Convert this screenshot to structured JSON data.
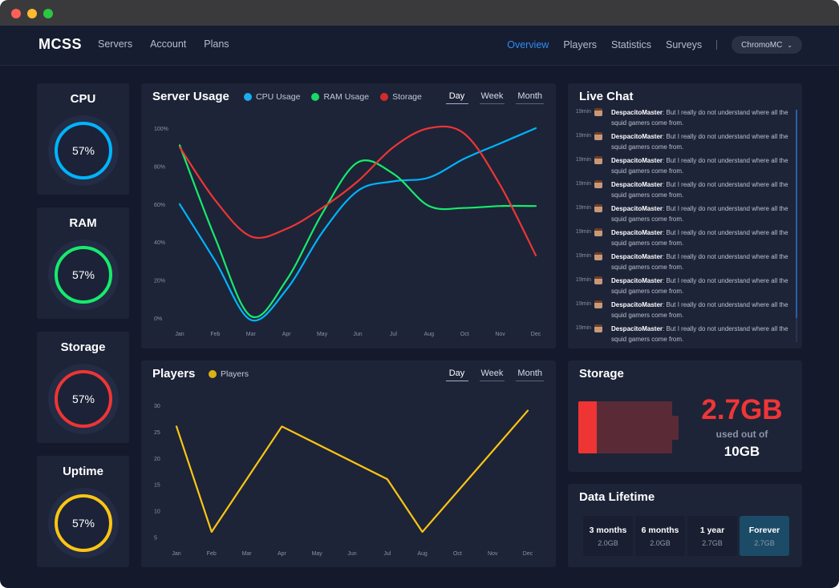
{
  "window": {
    "traffic_lights": [
      "close",
      "minimize",
      "zoom"
    ]
  },
  "nav": {
    "logo": "MCSS",
    "left_links": [
      "Servers",
      "Account",
      "Plans"
    ],
    "right_links": [
      {
        "label": "Overview",
        "active": true
      },
      {
        "label": "Players",
        "active": false
      },
      {
        "label": "Statistics",
        "active": false
      },
      {
        "label": "Surveys",
        "active": false
      }
    ],
    "separator": "|",
    "server_selector": "ChromoMC",
    "server_selector_icon": "chevron-down-icon"
  },
  "stats": [
    {
      "title": "CPU",
      "value": "57%",
      "percent": 57,
      "color": "#00b4ff"
    },
    {
      "title": "RAM",
      "value": "57%",
      "percent": 57,
      "color": "#16eb6c"
    },
    {
      "title": "Storage",
      "value": "57%",
      "percent": 57,
      "color": "#ee3534"
    },
    {
      "title": "Uptime",
      "value": "57%",
      "percent": 57,
      "color": "#fec513"
    }
  ],
  "server_usage": {
    "title": "Server Usage",
    "legend": [
      {
        "label": "CPU Usage",
        "color": "#19aef0"
      },
      {
        "label": "RAM Usage",
        "color": "#19d865"
      },
      {
        "label": "Storage",
        "color": "#d42c2c"
      }
    ],
    "tabs": [
      {
        "label": "Day",
        "active": true
      },
      {
        "label": "Week",
        "active": false
      },
      {
        "label": "Month",
        "active": false
      }
    ]
  },
  "players_panel": {
    "title": "Players",
    "legend": [
      {
        "label": "Players",
        "color": "#d8b217"
      }
    ],
    "tabs": [
      {
        "label": "Day",
        "active": true
      },
      {
        "label": "Week",
        "active": false
      },
      {
        "label": "Month",
        "active": false
      }
    ]
  },
  "chart_data": [
    {
      "type": "line",
      "title": "Server Usage",
      "x": [
        "Jan",
        "Feb",
        "Mar",
        "Apr",
        "May",
        "Jun",
        "Jul",
        "Aug",
        "Oct",
        "Nov",
        "Dec"
      ],
      "yticks": [
        "0%",
        "20%",
        "40%",
        "60%",
        "80%",
        "100%"
      ],
      "ylim": [
        0,
        100
      ],
      "smooth": true,
      "grid": false,
      "legend_position": "top",
      "series": [
        {
          "name": "CPU Usage",
          "color": "#00b4ff",
          "values": [
            60,
            30,
            -1,
            15,
            45,
            67,
            72,
            74,
            84,
            92,
            100
          ]
        },
        {
          "name": "RAM Usage",
          "color": "#16eb6c",
          "values": [
            91,
            42,
            1,
            20,
            55,
            82,
            76,
            59,
            58,
            59,
            59
          ]
        },
        {
          "name": "Storage",
          "color": "#ee3534",
          "values": [
            90,
            62,
            43,
            47,
            58,
            72,
            90,
            100,
            97,
            70,
            33
          ]
        }
      ]
    },
    {
      "type": "line",
      "title": "Players",
      "x": [
        "Jan",
        "Feb",
        "Mar",
        "Apr",
        "May",
        "Jun",
        "Jul",
        "Aug",
        "Oct",
        "Nov",
        "Dec"
      ],
      "yticks": [
        "5",
        "10",
        "15",
        "20",
        "25",
        "30"
      ],
      "ylim": [
        2.5,
        30
      ],
      "smooth": false,
      "grid": false,
      "legend_position": "top",
      "series": [
        {
          "name": "Players",
          "color": "#fec513",
          "points": [
            [
              0,
              26
            ],
            [
              1,
              6
            ],
            [
              2,
              16
            ],
            [
              3,
              26
            ],
            [
              6,
              16
            ],
            [
              7,
              6
            ],
            [
              10,
              29
            ]
          ]
        }
      ]
    }
  ],
  "live_chat": {
    "title": "Live Chat",
    "messages": [
      {
        "time": "19min",
        "user": "DespacitoMaster",
        "text": ": But I really do not understand where all the squid gamers come from."
      },
      {
        "time": "19min",
        "user": "DespacitoMaster",
        "text": ": But I really do not understand where all the squid gamers come from."
      },
      {
        "time": "19min",
        "user": "DespacitoMaster",
        "text": ": But I really do not understand where all the squid gamers come from."
      },
      {
        "time": "19min",
        "user": "DespacitoMaster",
        "text": ": But I really do not understand where all the squid gamers come from."
      },
      {
        "time": "19min",
        "user": "DespacitoMaster",
        "text": ": But I really do not understand where all the squid gamers come from."
      },
      {
        "time": "19min",
        "user": "DespacitoMaster",
        "text": ": But I really do not understand where all the squid gamers come from."
      },
      {
        "time": "19min",
        "user": "DespacitoMaster",
        "text": ": But I really do not understand where all the squid gamers come from."
      },
      {
        "time": "19min",
        "user": "DespacitoMaster",
        "text": ": But I really do not understand where all the squid gamers come from."
      },
      {
        "time": "19min",
        "user": "DespacitoMaster",
        "text": ": But I really do not understand where all the squid gamers come from."
      },
      {
        "time": "19min",
        "user": "DespacitoMaster",
        "text": ": But I really do not understand where all the squid gamers come from."
      }
    ]
  },
  "storage_panel": {
    "title": "Storage",
    "used": "2.7GB",
    "used_caption": "used out of",
    "total": "10GB",
    "fill_fraction": 0.2,
    "fill_color": "#ee3534",
    "empty_color": "#5a2b36",
    "icon": "battery-icon"
  },
  "data_lifetime": {
    "title": "Data Lifetime",
    "options": [
      {
        "label": "3 months",
        "size": "2.0GB",
        "active": false
      },
      {
        "label": "6 months",
        "size": "2.0GB",
        "active": false
      },
      {
        "label": "1 year",
        "size": "2.7GB",
        "active": false
      },
      {
        "label": "Forever",
        "size": "2.7GB",
        "active": true
      }
    ]
  }
}
